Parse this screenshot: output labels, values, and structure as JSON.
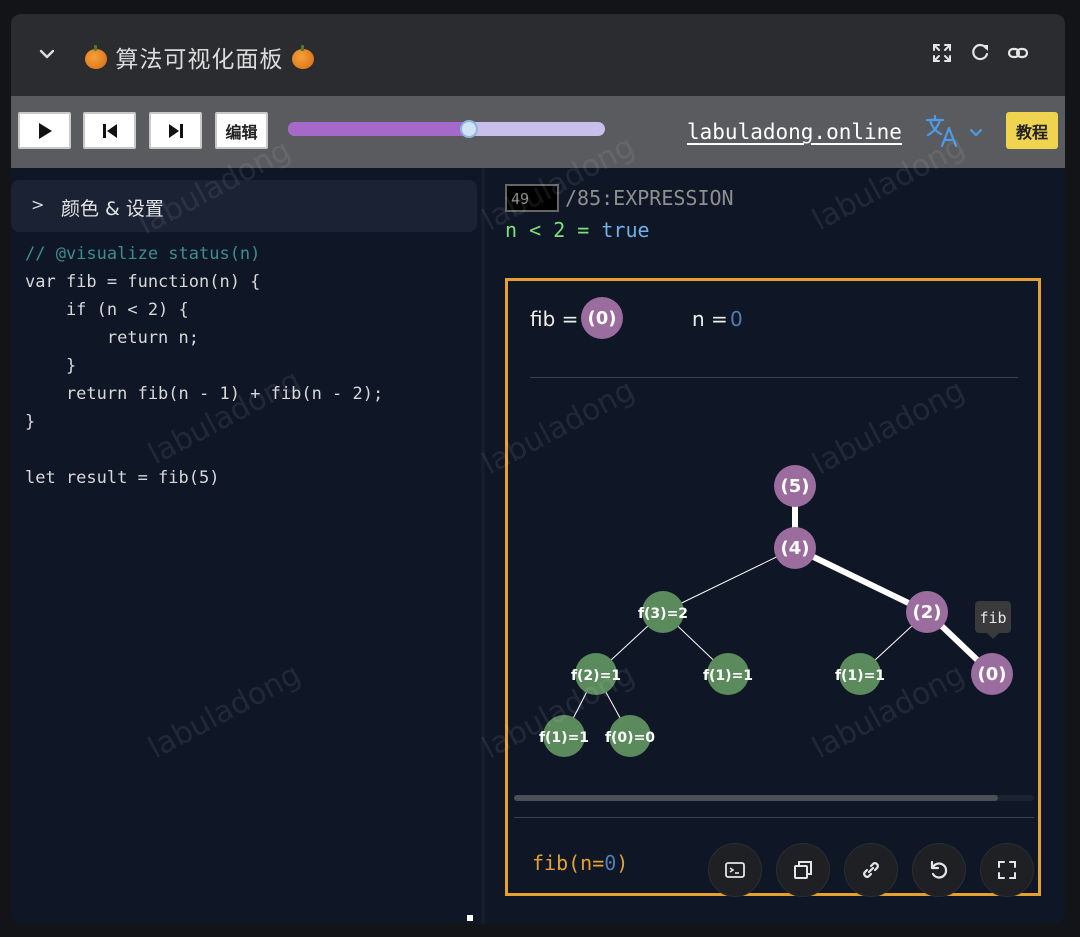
{
  "title": {
    "text": "算法可视化面板"
  },
  "toolbar": {
    "edit_label": "编辑",
    "site": "labuladong.online",
    "tutorial_label": "教程",
    "progress_fraction": 0.57
  },
  "left": {
    "settings_label": "颜色 & 设置",
    "code_lines": [
      "// @visualize status(n)",
      "var fib = function(n) {",
      "    if (n < 2) {",
      "        return n;",
      "    }",
      "    return fib(n - 1) + fib(n - 2);",
      "}",
      "",
      "let result = fib(5)"
    ]
  },
  "right": {
    "step_current": "49",
    "step_total": "/85:EXPRESSION",
    "expression": {
      "lhs": "n",
      "op": "<",
      "rhs": "2",
      "eq": "=",
      "result": "true"
    },
    "vars": {
      "fib_label": "fib =",
      "fib_node": "(0)",
      "n_label": "n =",
      "n_value": "0"
    },
    "tooltip": "fib",
    "call_text": "fib(n=",
    "call_value": "0",
    "call_close": ")"
  },
  "tree_nodes": [
    {
      "label": "(5)",
      "kind": "active"
    },
    {
      "label": "(4)",
      "kind": "active"
    },
    {
      "label": "f(3)=2",
      "kind": "done"
    },
    {
      "label": "(2)",
      "kind": "active"
    },
    {
      "label": "f(2)=1",
      "kind": "done"
    },
    {
      "label": "f(1)=1",
      "kind": "done"
    },
    {
      "label": "f(1)=1",
      "kind": "done"
    },
    {
      "label": "(0)",
      "kind": "active"
    },
    {
      "label": "f(1)=1",
      "kind": "done"
    },
    {
      "label": "f(0)=0",
      "kind": "done"
    }
  ],
  "watermark": "labuladong",
  "colors": {
    "active_node": "#9b6c9e",
    "done_node": "#5b8a5d",
    "frame_border": "#e6a02f",
    "tutorial_bg": "#f0d34e",
    "slider_fill": "#a569c9"
  }
}
